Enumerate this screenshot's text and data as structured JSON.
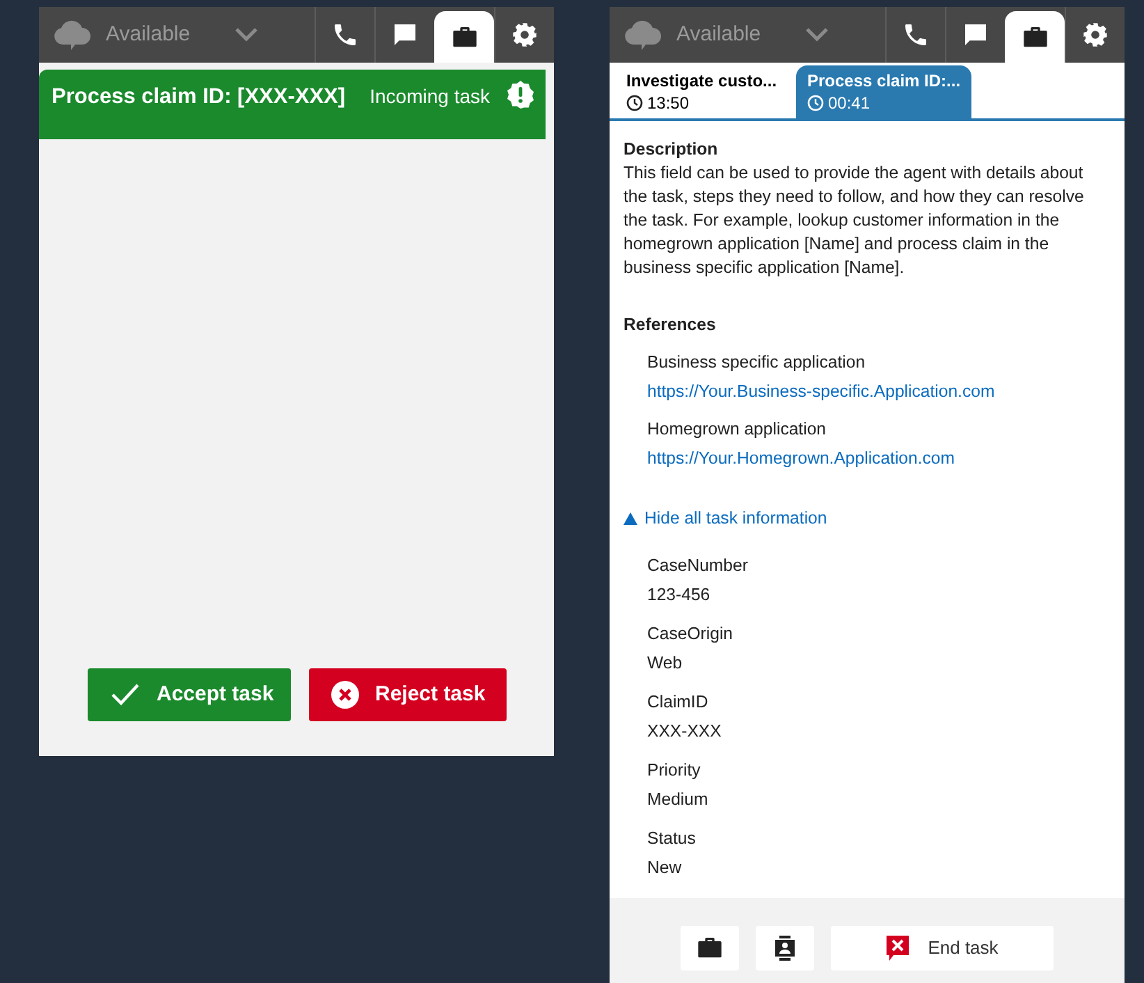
{
  "panels": [
    {
      "top_bar": {
        "status": "Available",
        "tabs": [
          {
            "kind": "phone",
            "selected": false
          },
          {
            "kind": "chat",
            "selected": false
          },
          {
            "kind": "task",
            "selected": true
          },
          {
            "kind": "settings",
            "selected": false
          }
        ]
      },
      "incoming": {
        "title": "Process claim ID: [XXX-XXX]",
        "label": "Incoming task"
      },
      "actions": [
        {
          "kind": "accept",
          "label": "Accept task"
        },
        {
          "kind": "reject",
          "label": "Reject task"
        }
      ]
    },
    {
      "top_bar": {
        "status": "Available",
        "tabs": [
          {
            "kind": "phone",
            "selected": false
          },
          {
            "kind": "chat",
            "selected": false
          },
          {
            "kind": "task",
            "selected": true
          },
          {
            "kind": "settings",
            "selected": false
          }
        ]
      },
      "task_tabs": [
        {
          "title": "Investigate custo...",
          "time": "13:50",
          "selected": false
        },
        {
          "title": "Process claim ID:...",
          "time": "00:41",
          "selected": true
        }
      ],
      "description": {
        "heading": "Description",
        "text": "This field can be used to provide the agent with details about the task, steps they need to follow, and how they can resolve the task. For example, lookup customer information in the homegrown application [Name] and process claim in the business specific application [Name]."
      },
      "references": {
        "heading": "References",
        "items": [
          {
            "label": "Business specific application",
            "url": "https://Your.Business-specific.Application.com"
          },
          {
            "label": "Homegrown application",
            "url": "https://Your.Homegrown.Application.com"
          }
        ]
      },
      "toggle": {
        "label": "Hide all task information",
        "expanded": true
      },
      "attributes": [
        {
          "name": "CaseNumber",
          "value": "123-456"
        },
        {
          "name": "CaseOrigin",
          "value": "Web"
        },
        {
          "name": "ClaimID",
          "value": "XXX-XXX"
        },
        {
          "name": "Priority",
          "value": "Medium"
        },
        {
          "name": "Status",
          "value": "New"
        }
      ],
      "footer": [
        {
          "kind": "task"
        },
        {
          "kind": "contacts"
        },
        {
          "kind": "end",
          "label": "End task"
        }
      ]
    }
  ]
}
